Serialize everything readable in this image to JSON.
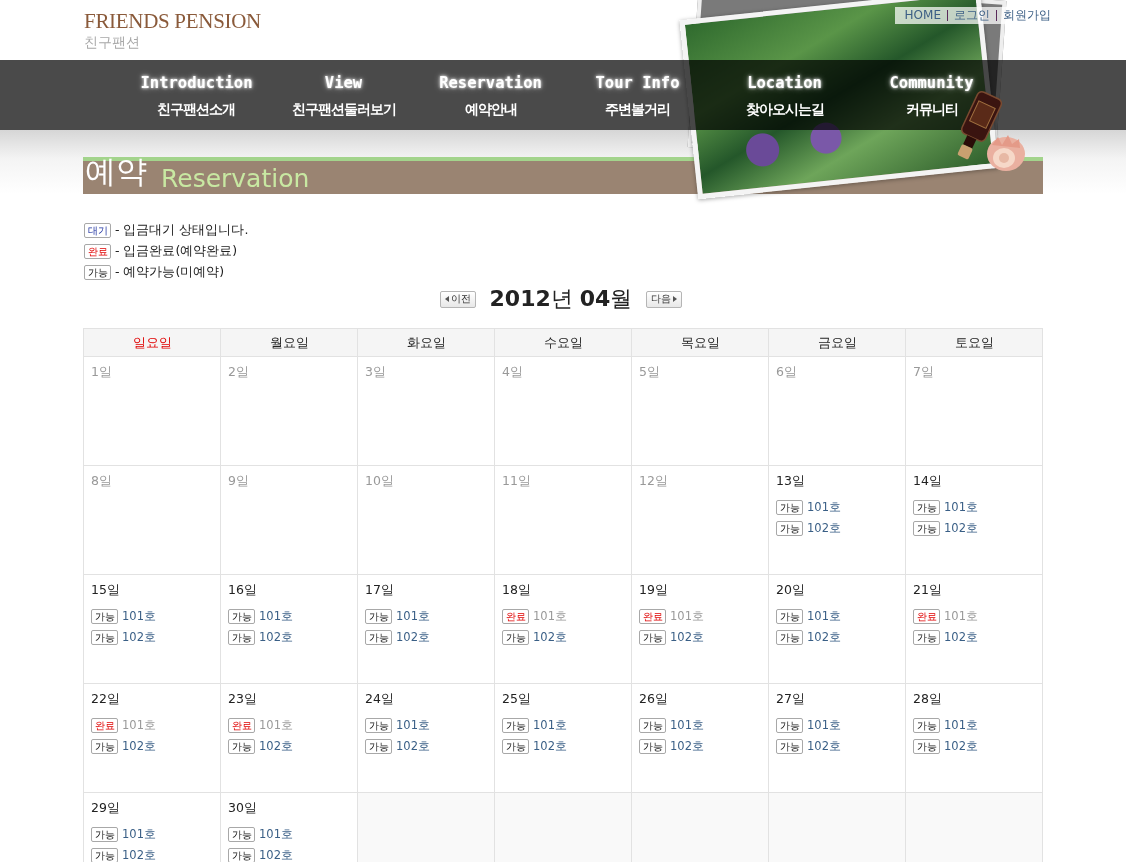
{
  "header": {
    "logo": "FRIENDS PENSION",
    "logo_sub": "친구팬션",
    "top_links": [
      "HOME",
      "로그인",
      "회원가입"
    ]
  },
  "nav": [
    {
      "en": "Introduction",
      "ko": "친구팬션소개"
    },
    {
      "en": "View",
      "ko": "친구팬션둘러보기"
    },
    {
      "en": "Reservation",
      "ko": "예약안내"
    },
    {
      "en": "Tour Info",
      "ko": "주변볼거리"
    },
    {
      "en": "Location",
      "ko": "찾아오시는길"
    },
    {
      "en": "Community",
      "ko": "커뮤니티"
    }
  ],
  "page_title": {
    "ko": "예약",
    "en": "Reservation"
  },
  "legend": [
    {
      "kind": "wait",
      "badge": "대기",
      "text": "- 입금대기 상태입니다."
    },
    {
      "kind": "booked",
      "badge": "완료",
      "text": "- 입금완료(예약완료)"
    },
    {
      "kind": "available",
      "badge": "가능",
      "text": "- 예약가능(미예약)"
    }
  ],
  "month_nav": {
    "prev": "이전",
    "title": "**2012**년 **04**월",
    "next": "다음"
  },
  "calendar": {
    "weekdays": [
      {
        "label": "일요일",
        "kind": "sunday"
      },
      {
        "label": "월요일",
        "kind": "weekday"
      },
      {
        "label": "화요일",
        "kind": "weekday"
      },
      {
        "label": "수요일",
        "kind": "weekday"
      },
      {
        "label": "목요일",
        "kind": "weekday"
      },
      {
        "label": "금요일",
        "kind": "weekday"
      },
      {
        "label": "토요일",
        "kind": "weekday"
      }
    ],
    "weeks": [
      {
        "cells": [
          {
            "kind": "day",
            "day": "1일",
            "past": true
          },
          {
            "kind": "day",
            "day": "2일",
            "past": true
          },
          {
            "kind": "day",
            "day": "3일",
            "past": true
          },
          {
            "kind": "day",
            "day": "4일",
            "past": true
          },
          {
            "kind": "day",
            "day": "5일",
            "past": true
          },
          {
            "kind": "day",
            "day": "6일",
            "past": true
          },
          {
            "kind": "day",
            "day": "7일",
            "past": true
          }
        ]
      },
      {
        "cells": [
          {
            "kind": "day",
            "day": "8일",
            "past": true
          },
          {
            "kind": "day",
            "day": "9일",
            "past": true
          },
          {
            "kind": "day",
            "day": "10일",
            "past": true
          },
          {
            "kind": "day",
            "day": "11일",
            "past": true
          },
          {
            "kind": "day",
            "day": "12일",
            "past": true
          },
          {
            "kind": "day",
            "day": "13일",
            "past": false,
            "rooms": [
              {
                "badge": "가능",
                "booked": false,
                "room": "101호"
              },
              {
                "badge": "가능",
                "booked": false,
                "room": "102호"
              }
            ]
          },
          {
            "kind": "day",
            "day": "14일",
            "past": false,
            "rooms": [
              {
                "badge": "가능",
                "booked": false,
                "room": "101호"
              },
              {
                "badge": "가능",
                "booked": false,
                "room": "102호"
              }
            ]
          }
        ]
      },
      {
        "cells": [
          {
            "kind": "day",
            "day": "15일",
            "past": false,
            "rooms": [
              {
                "badge": "가능",
                "booked": false,
                "room": "101호"
              },
              {
                "badge": "가능",
                "booked": false,
                "room": "102호"
              }
            ]
          },
          {
            "kind": "day",
            "day": "16일",
            "past": false,
            "rooms": [
              {
                "badge": "가능",
                "booked": false,
                "room": "101호"
              },
              {
                "badge": "가능",
                "booked": false,
                "room": "102호"
              }
            ]
          },
          {
            "kind": "day",
            "day": "17일",
            "past": false,
            "rooms": [
              {
                "badge": "가능",
                "booked": false,
                "room": "101호"
              },
              {
                "badge": "가능",
                "booked": false,
                "room": "102호"
              }
            ]
          },
          {
            "kind": "day",
            "day": "18일",
            "past": false,
            "rooms": [
              {
                "badge": "완료",
                "booked": true,
                "room": "101호"
              },
              {
                "badge": "가능",
                "booked": false,
                "room": "102호"
              }
            ]
          },
          {
            "kind": "day",
            "day": "19일",
            "past": false,
            "rooms": [
              {
                "badge": "완료",
                "booked": true,
                "room": "101호"
              },
              {
                "badge": "가능",
                "booked": false,
                "room": "102호"
              }
            ]
          },
          {
            "kind": "day",
            "day": "20일",
            "past": false,
            "rooms": [
              {
                "badge": "가능",
                "booked": false,
                "room": "101호"
              },
              {
                "badge": "가능",
                "booked": false,
                "room": "102호"
              }
            ]
          },
          {
            "kind": "day",
            "day": "21일",
            "past": false,
            "rooms": [
              {
                "badge": "완료",
                "booked": true,
                "room": "101호"
              },
              {
                "badge": "가능",
                "booked": false,
                "room": "102호"
              }
            ]
          }
        ]
      },
      {
        "cells": [
          {
            "kind": "day",
            "day": "22일",
            "past": false,
            "rooms": [
              {
                "badge": "완료",
                "booked": true,
                "room": "101호"
              },
              {
                "badge": "가능",
                "booked": false,
                "room": "102호"
              }
            ]
          },
          {
            "kind": "day",
            "day": "23일",
            "past": false,
            "rooms": [
              {
                "badge": "완료",
                "booked": true,
                "room": "101호"
              },
              {
                "badge": "가능",
                "booked": false,
                "room": "102호"
              }
            ]
          },
          {
            "kind": "day",
            "day": "24일",
            "past": false,
            "rooms": [
              {
                "badge": "가능",
                "booked": false,
                "room": "101호"
              },
              {
                "badge": "가능",
                "booked": false,
                "room": "102호"
              }
            ]
          },
          {
            "kind": "day",
            "day": "25일",
            "past": false,
            "rooms": [
              {
                "badge": "가능",
                "booked": false,
                "room": "101호"
              },
              {
                "badge": "가능",
                "booked": false,
                "room": "102호"
              }
            ]
          },
          {
            "kind": "day",
            "day": "26일",
            "past": false,
            "rooms": [
              {
                "badge": "가능",
                "booked": false,
                "room": "101호"
              },
              {
                "badge": "가능",
                "booked": false,
                "room": "102호"
              }
            ]
          },
          {
            "kind": "day",
            "day": "27일",
            "past": false,
            "rooms": [
              {
                "badge": "가능",
                "booked": false,
                "room": "101호"
              },
              {
                "badge": "가능",
                "booked": false,
                "room": "102호"
              }
            ]
          },
          {
            "kind": "day",
            "day": "28일",
            "past": false,
            "rooms": [
              {
                "badge": "가능",
                "booked": false,
                "room": "101호"
              },
              {
                "badge": "가능",
                "booked": false,
                "room": "102호"
              }
            ]
          }
        ]
      },
      {
        "cells": [
          {
            "kind": "day",
            "day": "29일",
            "past": false,
            "rooms": [
              {
                "badge": "가능",
                "booked": false,
                "room": "101호"
              },
              {
                "badge": "가능",
                "booked": false,
                "room": "102호"
              }
            ]
          },
          {
            "kind": "day",
            "day": "30일",
            "past": false,
            "rooms": [
              {
                "badge": "가능",
                "booked": false,
                "room": "101호"
              },
              {
                "badge": "가능",
                "booked": false,
                "room": "102호"
              }
            ]
          },
          {
            "kind": "blank"
          },
          {
            "kind": "blank"
          },
          {
            "kind": "blank"
          },
          {
            "kind": "blank"
          },
          {
            "kind": "blank"
          }
        ]
      }
    ]
  }
}
